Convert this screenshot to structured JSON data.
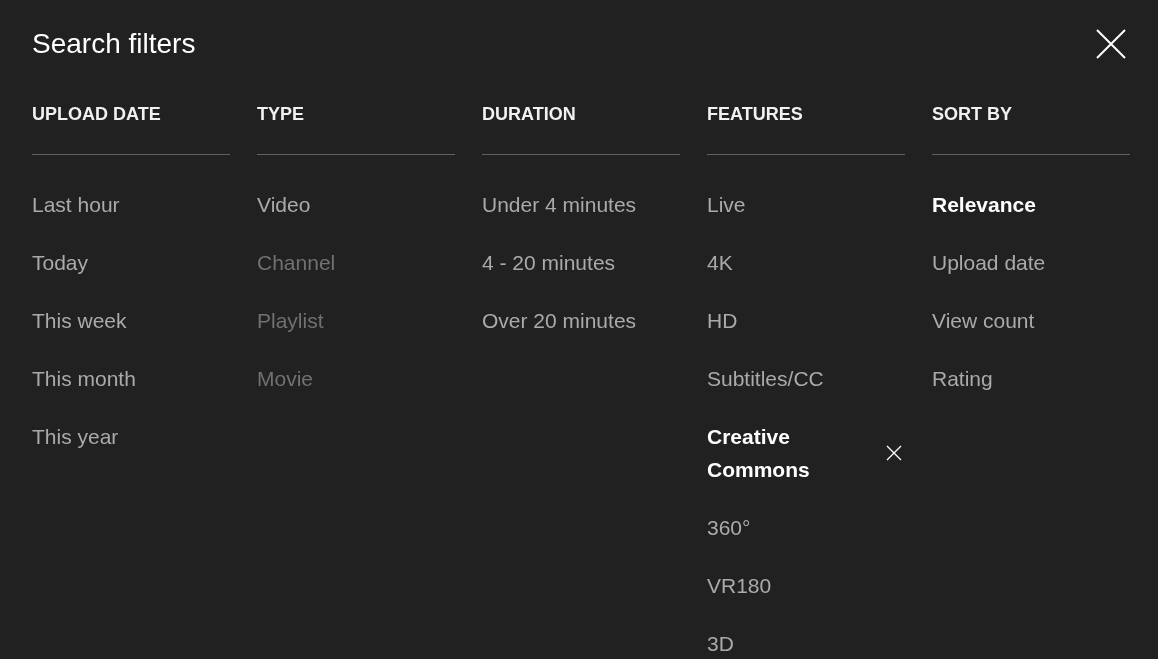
{
  "dialog": {
    "title": "Search filters"
  },
  "groups": [
    {
      "heading": "UPLOAD DATE",
      "items": [
        {
          "label": "Last hour",
          "selected": false,
          "disabled": false
        },
        {
          "label": "Today",
          "selected": false,
          "disabled": false
        },
        {
          "label": "This week",
          "selected": false,
          "disabled": false
        },
        {
          "label": "This month",
          "selected": false,
          "disabled": false
        },
        {
          "label": "This year",
          "selected": false,
          "disabled": false
        }
      ]
    },
    {
      "heading": "TYPE",
      "items": [
        {
          "label": "Video",
          "selected": false,
          "disabled": false
        },
        {
          "label": "Channel",
          "selected": false,
          "disabled": true
        },
        {
          "label": "Playlist",
          "selected": false,
          "disabled": true
        },
        {
          "label": "Movie",
          "selected": false,
          "disabled": true
        }
      ]
    },
    {
      "heading": "DURATION",
      "items": [
        {
          "label": "Under 4 minutes",
          "selected": false,
          "disabled": false
        },
        {
          "label": "4 - 20 minutes",
          "selected": false,
          "disabled": false
        },
        {
          "label": "Over 20 minutes",
          "selected": false,
          "disabled": false
        }
      ]
    },
    {
      "heading": "FEATURES",
      "clearable": true,
      "items": [
        {
          "label": "Live",
          "selected": false,
          "disabled": false
        },
        {
          "label": "4K",
          "selected": false,
          "disabled": false
        },
        {
          "label": "HD",
          "selected": false,
          "disabled": false
        },
        {
          "label": "Subtitles/CC",
          "selected": false,
          "disabled": false
        },
        {
          "label": "Creative Commons",
          "selected": true,
          "disabled": false
        },
        {
          "label": "360°",
          "selected": false,
          "disabled": false
        },
        {
          "label": "VR180",
          "selected": false,
          "disabled": false
        },
        {
          "label": "3D",
          "selected": false,
          "disabled": false
        }
      ]
    },
    {
      "heading": "SORT BY",
      "clearable": false,
      "items": [
        {
          "label": "Relevance",
          "selected": true,
          "disabled": false
        },
        {
          "label": "Upload date",
          "selected": false,
          "disabled": false
        },
        {
          "label": "View count",
          "selected": false,
          "disabled": false
        },
        {
          "label": "Rating",
          "selected": false,
          "disabled": false
        }
      ]
    }
  ]
}
